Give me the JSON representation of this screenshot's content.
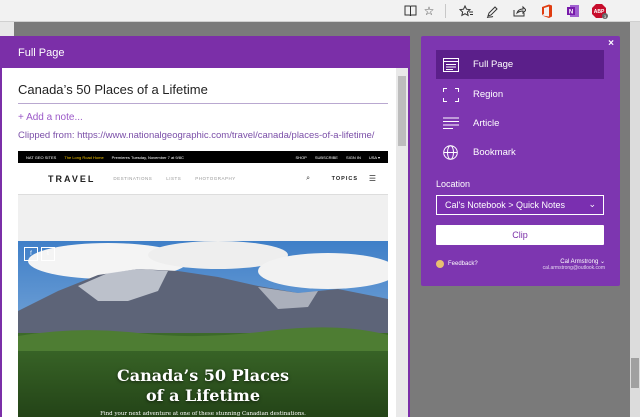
{
  "toolbar": {
    "icons": [
      "reading-view-icon",
      "favorite-star-icon",
      "favorites-hub-icon",
      "pen-icon",
      "share-icon",
      "office-icon",
      "onenote-icon",
      "adblock-icon"
    ],
    "adblock_label": "ABP",
    "adblock_badge": "3"
  },
  "preview": {
    "header": "Full Page",
    "note_title": "Canada’s 50 Places of a Lifetime",
    "add_note": "+ Add a note...",
    "clipped_from": "Clipped from: https://www.nationalgeographic.com/travel/canada/places-of-a-lifetime/",
    "web": {
      "top_left": "NAT GEO SITES",
      "promo": "The Long Road Home",
      "promo_rest": "Premieres Tuesday, November 7 at 9/8C",
      "shop": "SHOP",
      "subscribe": "SUBSCRIBE",
      "signin": "SIGN IN",
      "region": "USA ▾",
      "section": "TRAVEL",
      "links": [
        "DESTINATIONS",
        "LISTS",
        "PHOTOGRAPHY"
      ],
      "topics": "TOPICS",
      "hero_title_1": "Canada’s 50 Places",
      "hero_title_2": "of a Lifetime",
      "hero_sub": "Find your next adventure at one of these stunning Canadian destinations."
    }
  },
  "clipper": {
    "close": "×",
    "modes": [
      {
        "label": "Full Page",
        "icon": "full-page-icon",
        "selected": true
      },
      {
        "label": "Region",
        "icon": "region-icon",
        "selected": false
      },
      {
        "label": "Article",
        "icon": "article-icon",
        "selected": false
      },
      {
        "label": "Bookmark",
        "icon": "bookmark-globe-icon",
        "selected": false
      }
    ],
    "location_label": "Location",
    "location_value": "Cal's Notebook > Quick Notes",
    "clip_label": "Clip",
    "feedback": "Feedback?",
    "user_name": "Cal Armstrong",
    "user_email": "cal.armstrong@outlook.com"
  },
  "colors": {
    "purple": "#7b2fa8",
    "purple_dark": "#5b1f8a"
  }
}
